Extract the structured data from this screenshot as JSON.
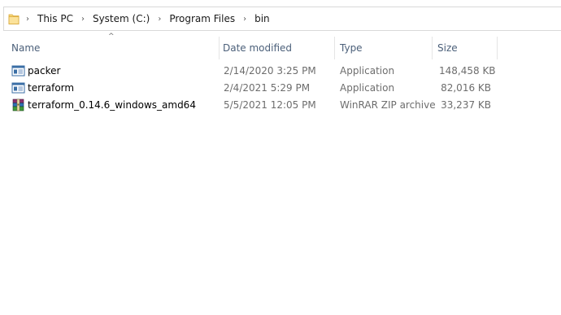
{
  "breadcrumb": {
    "items": [
      "This PC",
      "System (C:)",
      "Program Files",
      "bin"
    ]
  },
  "columns": {
    "name": "Name",
    "date_modified": "Date modified",
    "type": "Type",
    "size": "Size"
  },
  "files": [
    {
      "name": "packer",
      "date_modified": "2/14/2020 3:25 PM",
      "type": "Application",
      "size": "148,458 KB",
      "icon": "application-icon"
    },
    {
      "name": "terraform",
      "date_modified": "2/4/2021 5:29 PM",
      "type": "Application",
      "size": "82,016 KB",
      "icon": "application-icon"
    },
    {
      "name": "terraform_0.14.6_windows_amd64",
      "date_modified": "5/5/2021 12:05 PM",
      "type": "WinRAR ZIP archive",
      "size": "33,237 KB",
      "icon": "winrar-archive-icon"
    }
  ],
  "colors": {
    "header_text": "#4c607a",
    "detail_text": "#6d6d6d",
    "folder_yellow": "#f8d775"
  }
}
